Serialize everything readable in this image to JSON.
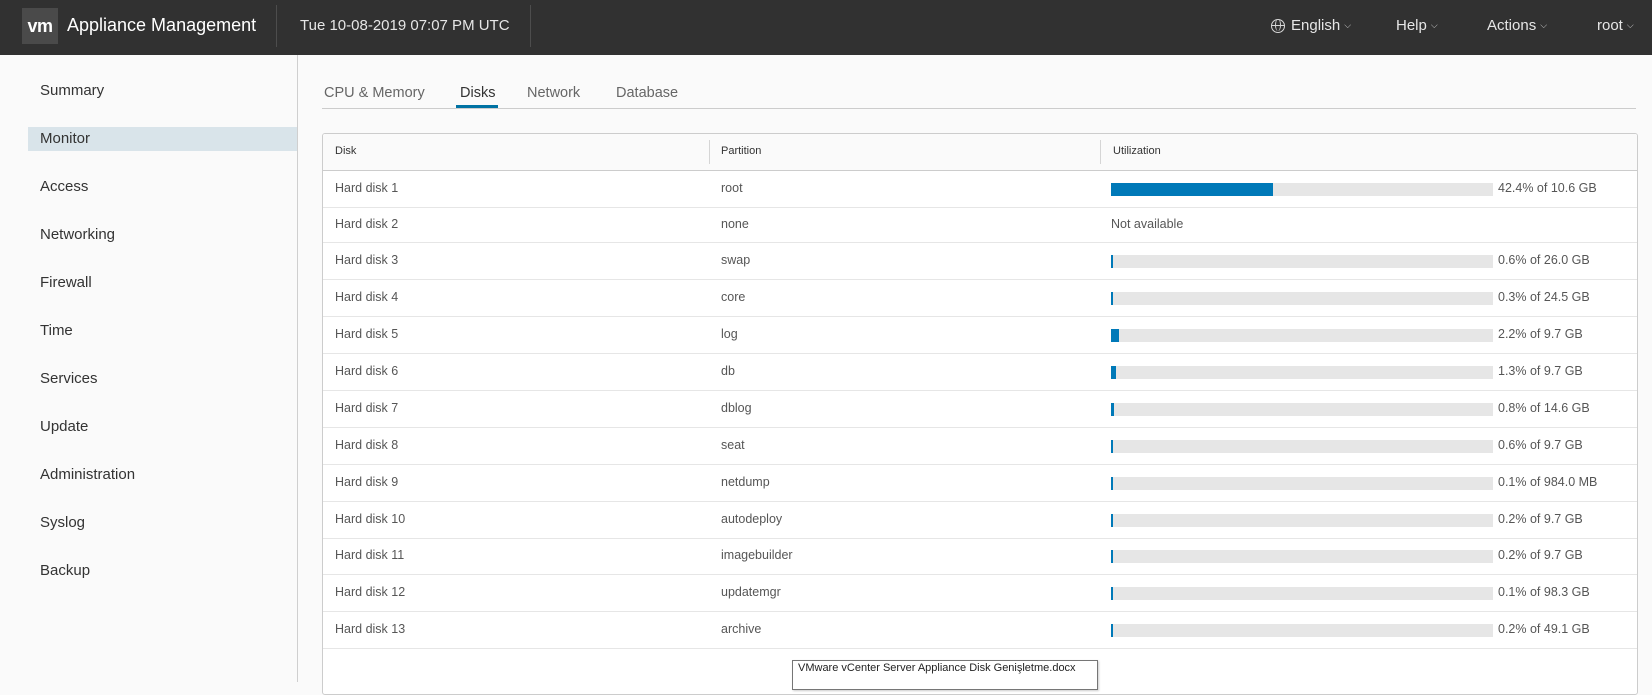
{
  "header": {
    "logo": "vm",
    "title": "Appliance Management",
    "datetime": "Tue 10-08-2019 07:07 PM UTC",
    "language": "English",
    "help": "Help",
    "actions": "Actions",
    "user": "root"
  },
  "sidebar": {
    "items": [
      {
        "label": "Summary",
        "active": false
      },
      {
        "label": "Monitor",
        "active": true
      },
      {
        "label": "Access",
        "active": false
      },
      {
        "label": "Networking",
        "active": false
      },
      {
        "label": "Firewall",
        "active": false
      },
      {
        "label": "Time",
        "active": false
      },
      {
        "label": "Services",
        "active": false
      },
      {
        "label": "Update",
        "active": false
      },
      {
        "label": "Administration",
        "active": false
      },
      {
        "label": "Syslog",
        "active": false
      },
      {
        "label": "Backup",
        "active": false
      }
    ]
  },
  "tabs": [
    {
      "label": "CPU & Memory",
      "active": false
    },
    {
      "label": "Disks",
      "active": true
    },
    {
      "label": "Network",
      "active": false
    },
    {
      "label": "Database",
      "active": false
    }
  ],
  "grid": {
    "columns": [
      "Disk",
      "Partition",
      "Utilization"
    ],
    "rows": [
      {
        "disk": "Hard disk 1",
        "partition": "root",
        "percent": 42.4,
        "text": "42.4% of 10.6 GB"
      },
      {
        "disk": "Hard disk 2",
        "partition": "none",
        "percent": null,
        "text": "Not available"
      },
      {
        "disk": "Hard disk 3",
        "partition": "swap",
        "percent": 0.6,
        "text": "0.6% of 26.0 GB"
      },
      {
        "disk": "Hard disk 4",
        "partition": "core",
        "percent": 0.3,
        "text": "0.3% of 24.5 GB"
      },
      {
        "disk": "Hard disk 5",
        "partition": "log",
        "percent": 2.2,
        "text": "2.2% of 9.7 GB"
      },
      {
        "disk": "Hard disk 6",
        "partition": "db",
        "percent": 1.3,
        "text": "1.3% of 9.7 GB"
      },
      {
        "disk": "Hard disk 7",
        "partition": "dblog",
        "percent": 0.8,
        "text": "0.8% of 14.6 GB"
      },
      {
        "disk": "Hard disk 8",
        "partition": "seat",
        "percent": 0.6,
        "text": "0.6% of 9.7 GB"
      },
      {
        "disk": "Hard disk 9",
        "partition": "netdump",
        "percent": 0.1,
        "text": "0.1% of 984.0 MB"
      },
      {
        "disk": "Hard disk 10",
        "partition": "autodeploy",
        "percent": 0.2,
        "text": "0.2% of 9.7 GB"
      },
      {
        "disk": "Hard disk 11",
        "partition": "imagebuilder",
        "percent": 0.2,
        "text": "0.2% of 9.7 GB"
      },
      {
        "disk": "Hard disk 12",
        "partition": "updatemgr",
        "percent": 0.1,
        "text": "0.1% of 98.3 GB"
      },
      {
        "disk": "Hard disk 13",
        "partition": "archive",
        "percent": 0.2,
        "text": "0.2% of 49.1 GB"
      }
    ]
  },
  "tooltip": {
    "text": "VMware vCenter Server Appliance Disk Genişletme.docx"
  },
  "colors": {
    "header_bg": "#313131",
    "accent": "#0079b8",
    "nav_active_bg": "#d9e4ea",
    "bar_track": "#e6e6e6"
  }
}
